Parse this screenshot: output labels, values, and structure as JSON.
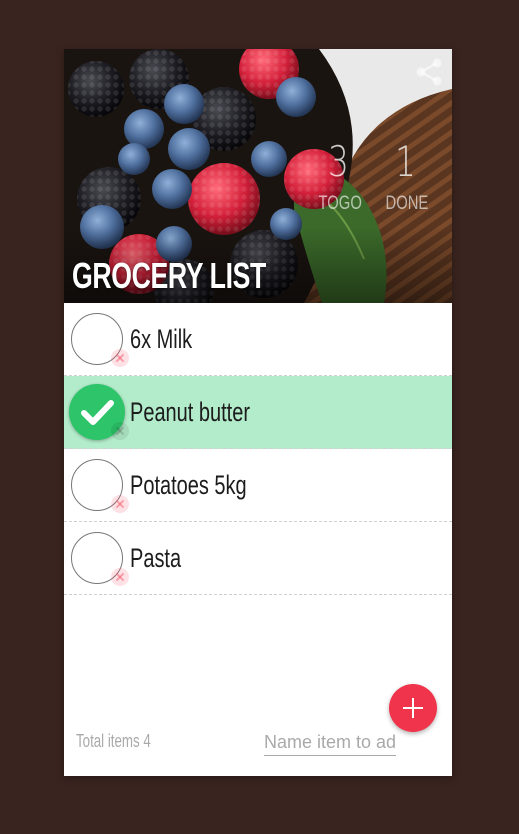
{
  "header": {
    "title": "GROCERY LIST",
    "togo_count": "3",
    "togo_label": "TOGO",
    "done_count": "1",
    "done_label": "DONE"
  },
  "icons": {
    "share": "share-icon",
    "check": "checkmark-icon",
    "delete": "close-icon",
    "add": "plus-icon"
  },
  "items": [
    {
      "label": "6x Milk",
      "done": false
    },
    {
      "label": "Peanut butter",
      "done": true
    },
    {
      "label": "Potatoes 5kg",
      "done": false
    },
    {
      "label": "Pasta",
      "done": false
    }
  ],
  "footer": {
    "total_label": "Total items 4",
    "input_placeholder": "Name item to add.",
    "input_value": ""
  },
  "colors": {
    "background": "#3a241f",
    "done_row": "#b2ecca",
    "check_fill": "#2dc46a",
    "fab": "#f0344b"
  }
}
